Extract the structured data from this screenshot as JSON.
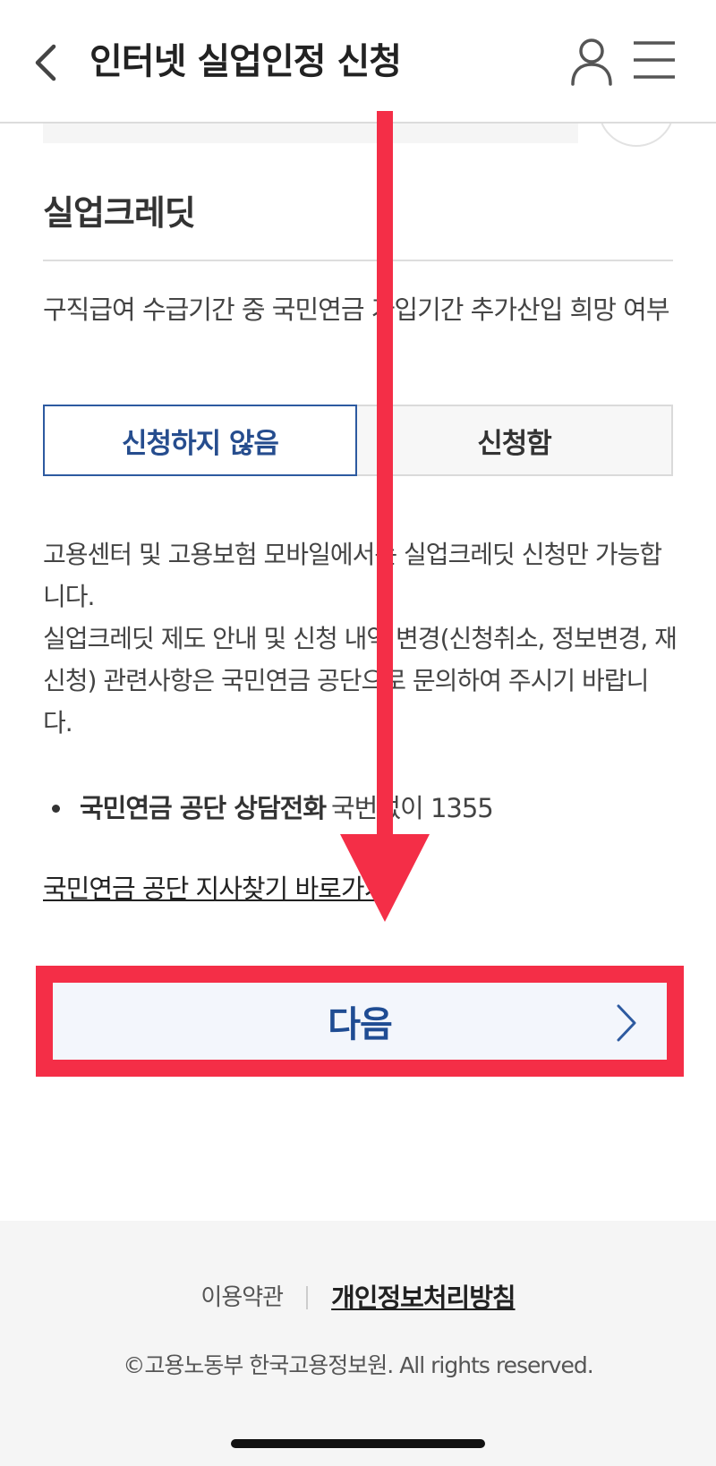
{
  "header": {
    "title": "인터넷 실업인정 신청",
    "back_icon": "chevron-left-icon",
    "user_icon": "user-icon",
    "menu_icon": "hamburger-menu-icon"
  },
  "credit": {
    "section_title": "실업크레딧",
    "question": "구직급여 수급기간 중 국민연금 가입기간 추가산입 희망 여부",
    "options": [
      "신청하지 않음",
      "신청함"
    ],
    "selected_option": "신청하지 않음",
    "notice": [
      "고용센터 및 고용보험 모바일에서는 실업크레딧 신청만 가능합니다.",
      "실업크레딧 제도 안내 및 신청 내역 변경(신청취소, 정보변경, 재신청) 관련사항은 국민연금 공단으로 문의하여 주시기 바랍니다."
    ],
    "contact_label": "국민연금 공단 상담전화",
    "contact_value": "국번없이 1355",
    "branch_link": "국민연금 공단 지사찾기 바로가기"
  },
  "next_button": {
    "label": "다음",
    "icon": "chevron-right-icon"
  },
  "footer": {
    "terms": "이용약관",
    "privacy": "개인정보처리방침",
    "copyright": "©고용노동부 한국고용정보원. All rights reserved."
  },
  "colors": {
    "accent_blue": "#264d8e",
    "annotation_red": "#f42e47",
    "button_bg": "#f3f6fc"
  }
}
